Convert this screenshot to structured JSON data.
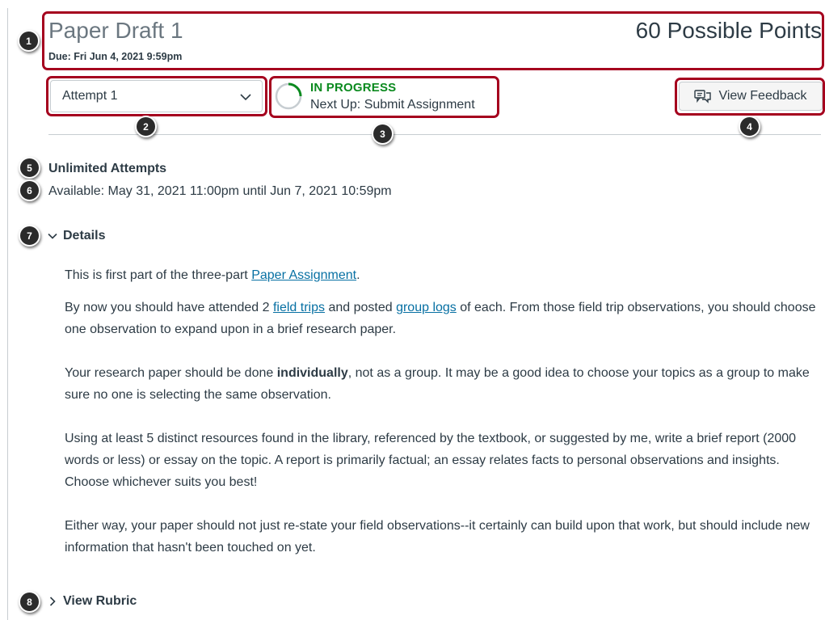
{
  "header": {
    "title": "Paper Draft 1",
    "due": "Due: Fri Jun 4, 2021 9:59pm",
    "points": "60 Possible Points"
  },
  "attempt": {
    "selected": "Attempt 1"
  },
  "status": {
    "state": "IN PROGRESS",
    "next_up": "Next Up: Submit Assignment",
    "color": "#0b8a1f"
  },
  "feedback_button": {
    "label": "View Feedback"
  },
  "info": {
    "attempts": "Unlimited Attempts",
    "availability": "Available: May 31, 2021 11:00pm until Jun 7, 2021 10:59pm"
  },
  "details": {
    "label": "Details",
    "p1_before": "This is first part of the three-part ",
    "p1_link": "Paper Assignment",
    "p1_after": ".",
    "p2_before": "By now you should have attended 2 ",
    "p2_link1": "field trips",
    "p2_mid": " and posted ",
    "p2_link2": "group logs",
    "p2_after": " of each. From those field trip observations, you should choose one observation to expand upon in a brief research paper.",
    "p3_before": "Your research paper should be done ",
    "p3_bold": "individually",
    "p3_after": ", not as a group. It may be a good idea to choose your topics as a group to make sure no one is selecting the same observation.",
    "p4": "Using at least 5 distinct resources found in the library, referenced by the textbook, or suggested by me, write a brief report (2000 words or less) or essay on the topic. A report is primarily factual; an essay relates facts to personal observations and insights. Choose whichever suits you best!",
    "p5": "Either way, your paper should not just re-state your field observations--it certainly can build upon that work, but should include new information that hasn't been touched on yet."
  },
  "rubric": {
    "label": "View Rubric"
  },
  "callouts": [
    "1",
    "2",
    "3",
    "4",
    "5",
    "6",
    "7",
    "8"
  ],
  "colors": {
    "callout_border": "#a5001e",
    "link": "#0770a3",
    "text": "#2d3b45"
  }
}
